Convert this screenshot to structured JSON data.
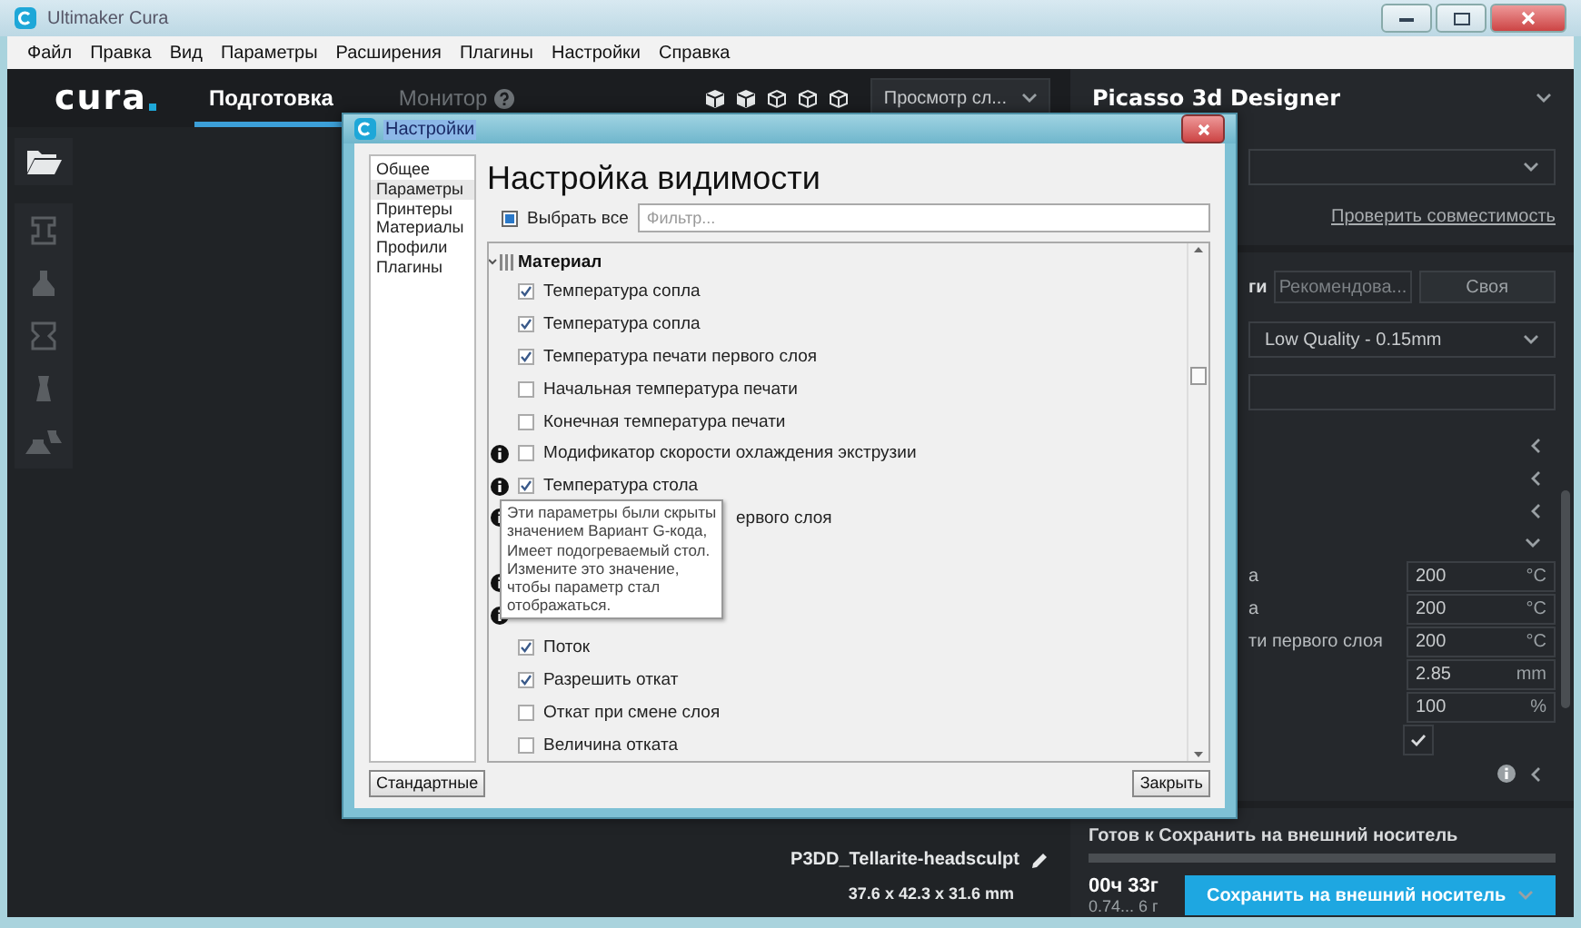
{
  "window": {
    "title": "Ultimaker Cura"
  },
  "menu": [
    "Файл",
    "Правка",
    "Вид",
    "Параметры",
    "Расширения",
    "Плагины",
    "Настройки",
    "Справка"
  ],
  "header": {
    "logo": "cura",
    "tabs": [
      {
        "label": "Подготовка",
        "selected": true
      },
      {
        "label": "Монитор",
        "selected": false
      }
    ],
    "view_dropdown": "Просмотр сл..."
  },
  "printer_panel": {
    "title": "Picasso 3d Designer",
    "check_link": "Проверить совместимость",
    "setup_label": "ги",
    "modes": [
      {
        "label": "Рекомендова...",
        "selected": false
      },
      {
        "label": "Своя",
        "selected": true
      }
    ],
    "profile": "Low Quality - 0.15mm",
    "settings": [
      {
        "label": "а",
        "value": "200",
        "unit": "°C"
      },
      {
        "label": "а",
        "value": "200",
        "unit": "°C"
      },
      {
        "label": "ти первого слоя",
        "value": "200",
        "unit": "°C"
      },
      {
        "value": "2.85",
        "unit": "mm"
      },
      {
        "value": "100",
        "unit": "%"
      }
    ],
    "toggle": {
      "checked": true
    }
  },
  "job": {
    "status": "Готов к Сохранить на внешний носитель",
    "time": "00ч 33г",
    "material": "0.74... 6 г",
    "save_button": "Сохранить на внешний носитель"
  },
  "model": {
    "name": "P3DD_Tellarite-headsculpt",
    "dimensions": "37.6 x 42.3 x 31.6 mm"
  },
  "dialog": {
    "title": "Настройки",
    "nav": [
      {
        "label": "Общее",
        "selected": false
      },
      {
        "label": "Параметры",
        "selected": true
      },
      {
        "label": "Принтеры",
        "selected": false
      },
      {
        "label": "Материалы",
        "selected": false
      },
      {
        "label": "Профили",
        "selected": false
      },
      {
        "label": "Плагины",
        "selected": false
      }
    ],
    "heading": "Настройка видимости",
    "select_all": {
      "label": "Выбрать все",
      "indeterminate": true
    },
    "filter": {
      "placeholder": "Фильтр..."
    },
    "category": {
      "label": "Материал",
      "expanded": true
    },
    "settings": [
      {
        "kind": "setting",
        "label": "Температура сопла",
        "checked": true,
        "info": false
      },
      {
        "kind": "setting",
        "label": "Температура сопла",
        "checked": true,
        "info": false
      },
      {
        "kind": "setting",
        "label": "Температура печати первого слоя",
        "checked": true,
        "info": false
      },
      {
        "kind": "setting",
        "label": "Начальная температура печати",
        "checked": false,
        "info": false
      },
      {
        "kind": "setting",
        "label": "Конечная температура печати",
        "checked": false,
        "info": false
      },
      {
        "kind": "setting",
        "label": "Модификатор скорости охлаждения экструзии",
        "checked": false,
        "info": true
      },
      {
        "kind": "setting",
        "label": "Температура стола",
        "checked": true,
        "info": true
      },
      {
        "kind": "covered",
        "label": "ервого слоя",
        "info": true
      },
      {
        "kind": "covered",
        "info": false
      },
      {
        "kind": "covered",
        "info": true
      },
      {
        "kind": "covered",
        "info": true
      },
      {
        "kind": "setting",
        "label": "Поток",
        "checked": true,
        "info": false
      },
      {
        "kind": "setting",
        "label": "Разрешить откат",
        "checked": true,
        "info": false
      },
      {
        "kind": "setting",
        "label": "Откат при смене слоя",
        "checked": false,
        "info": false
      },
      {
        "kind": "setting",
        "label": "Величина отката",
        "checked": false,
        "info": false
      }
    ],
    "tooltip": "Эти параметры были скрыты\nзначением Вариант G-кода,\nИмеет подогреваемый стол.\nИзмените это значение,\nчтобы параметр стал\nотображаться.",
    "defaults_button": "Стандартные",
    "close_button": "Закрыть"
  }
}
